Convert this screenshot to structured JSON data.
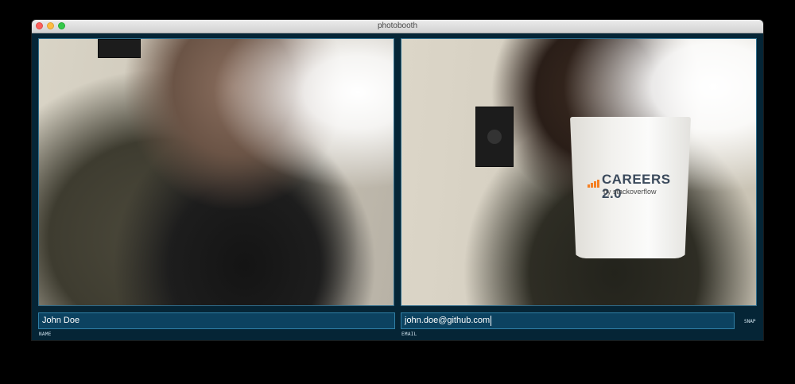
{
  "window": {
    "title": "photobooth"
  },
  "feeds": {
    "right_mug_logo": "CAREERS 2.0",
    "right_mug_sub": "by stackoverflow"
  },
  "form": {
    "name_value": "John Doe",
    "name_label": "NAME",
    "email_value": "john.doe@github.com",
    "email_label": "EMAIL",
    "snap_label": "SNAP"
  },
  "colors": {
    "background": "#052536",
    "field_bg": "#0c4260",
    "field_border": "#2f7fa6",
    "accent_logo": "#f48024"
  }
}
